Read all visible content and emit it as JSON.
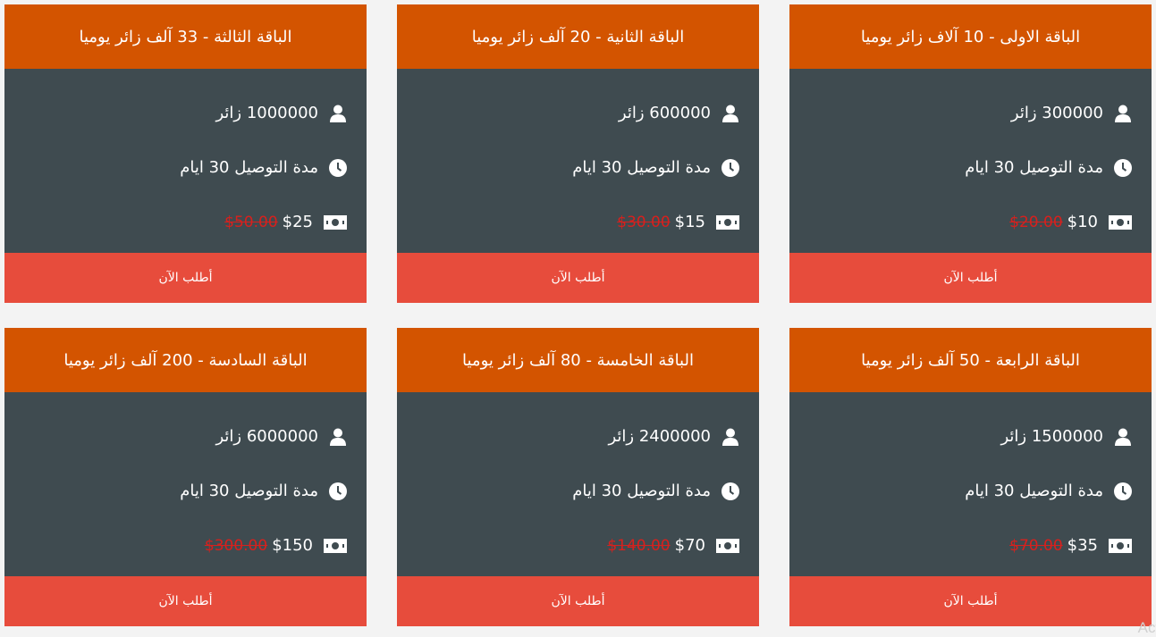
{
  "icons": {
    "visitors": "user-icon",
    "duration": "clock-icon",
    "price": "money-icon"
  },
  "colors": {
    "header": "#d35400",
    "body": "#3f4b50",
    "button": "#e74c3c",
    "old_price": "#d8201d",
    "background": "#f3f3f3"
  },
  "packages": [
    {
      "title": "الباقة الاولى - 10 آلاف زائر يوميا",
      "visitors": "300000 زائر",
      "duration": "مدة التوصيل 30 ايام",
      "price": "$10",
      "old_price": "$20.00",
      "button": "أطلب الآن"
    },
    {
      "title": "الباقة الثانية - 20 آلف زائر يوميا",
      "visitors": "600000 زائر",
      "duration": "مدة التوصيل 30 ايام",
      "price": "$15",
      "old_price": "$30.00",
      "button": "أطلب الآن"
    },
    {
      "title": "الباقة الثالثة - 33 آلف زائر يوميا",
      "visitors": "1000000 زائر",
      "duration": "مدة التوصيل 30 ايام",
      "price": "$25",
      "old_price": "$50.00",
      "button": "أطلب الآن"
    },
    {
      "title": "الباقة الرابعة - 50 آلف زائر يوميا",
      "visitors": "1500000 زائر",
      "duration": "مدة التوصيل 30 ايام",
      "price": "$35",
      "old_price": "$70.00",
      "button": "أطلب الآن"
    },
    {
      "title": "الباقة الخامسة - 80 آلف زائر يوميا",
      "visitors": "2400000 زائر",
      "duration": "مدة التوصيل 30 ايام",
      "price": "$70",
      "old_price": "$140.00",
      "button": "أطلب الآن"
    },
    {
      "title": "الباقة السادسة - 200 آلف زائر يوميا",
      "visitors": "6000000 زائر",
      "duration": "مدة التوصيل 30 ايام",
      "price": "$150",
      "old_price": "$300.00",
      "button": "أطلب الآن"
    }
  ],
  "watermark": "Acti"
}
